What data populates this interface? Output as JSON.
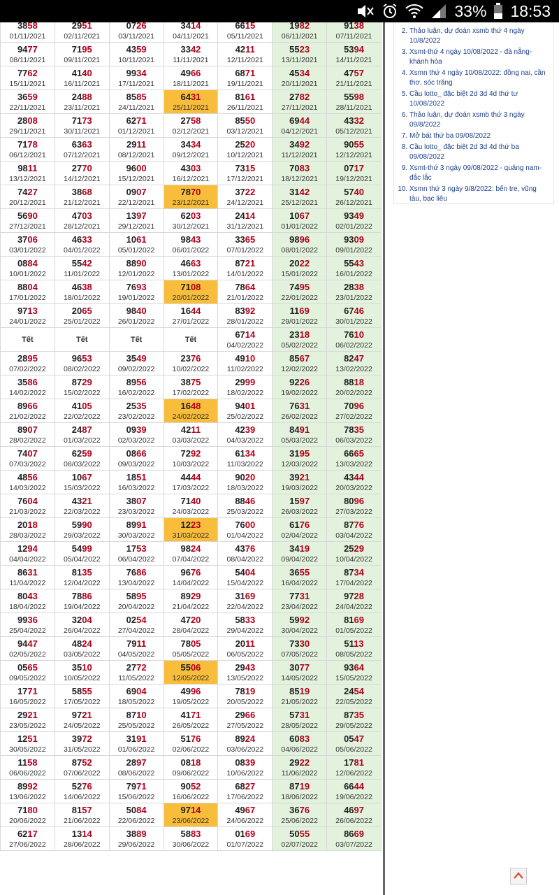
{
  "status": {
    "battery_pct": "33%",
    "time": "18:53"
  },
  "icons": {
    "mute": "mute-icon",
    "alarm": "alarm-icon",
    "wifi": "wifi-icon",
    "signal": "signal-icon",
    "battery": "battery-icon",
    "scroll_top": "chevron-up-icon"
  },
  "colors": {
    "highlight": "#b3001b",
    "weekend": "#e3f2dc",
    "special": "#f8bd3b"
  },
  "sidebar": {
    "start": 2,
    "items": [
      "Thảo luận, dự đoán xsmb thứ 4 ngày 10/8/2022",
      "Xsmt-thứ 4 ngày 10/08/2022 - đà nẵng-khánh hòa",
      "Xsmn thứ 4 ngày 10/08/2022: đồng nai, cần thơ, sóc trăng",
      "Cầu lotto_ đặc biệt 2d 3d 4d thứ tư 10/08/2022",
      "Thảo luận, dự đoán xsmb thứ 3 ngày 09/8/2022",
      "Mở bát thứ ba 09/08/2022",
      "Cầu lotto_ đặc biệt 2d 3d 4d thứ ba 09/08/2022",
      "Xsmt-thứ 3 ngày 09/08/2022 - quảng nam-đắc lắc",
      "Xsmn thứ 3 ngày 9/8/2022: bến tre, vũng tàu, bạc liêu"
    ]
  },
  "results": [
    [
      [
        "03858",
        "01/11/2021"
      ],
      [
        "02951",
        "02/11/2021"
      ],
      [
        "00726",
        "03/11/2021"
      ],
      [
        "03414",
        "04/11/2021"
      ],
      [
        "06615",
        "05/11/2021"
      ],
      [
        "01982",
        "06/11/2021"
      ],
      [
        "09138",
        "07/11/2021"
      ]
    ],
    [
      [
        "09477",
        "08/11/2021"
      ],
      [
        "07195",
        "09/11/2021"
      ],
      [
        "04359",
        "10/11/2021"
      ],
      [
        "03342",
        "11/11/2021"
      ],
      [
        "04211",
        "12/11/2021"
      ],
      [
        "05523",
        "13/11/2021"
      ],
      [
        "05394",
        "14/11/2021"
      ]
    ],
    [
      [
        "07762",
        "15/11/2021"
      ],
      [
        "04140",
        "16/11/2021"
      ],
      [
        "09934",
        "17/11/2021"
      ],
      [
        "04966",
        "18/11/2021"
      ],
      [
        "06871",
        "19/11/2021"
      ],
      [
        "04534",
        "20/11/2021"
      ],
      [
        "04757",
        "21/11/2021"
      ]
    ],
    [
      [
        "03659",
        "22/11/2021"
      ],
      [
        "02488",
        "23/11/2021"
      ],
      [
        "08585",
        "24/11/2021"
      ],
      [
        "06431",
        "25/11/2021",
        "sp"
      ],
      [
        "08161",
        "26/11/2021"
      ],
      [
        "02782",
        "27/11/2021"
      ],
      [
        "05598",
        "28/11/2021"
      ]
    ],
    [
      [
        "02808",
        "29/11/2021"
      ],
      [
        "07173",
        "30/11/2021"
      ],
      [
        "06271",
        "01/12/2021"
      ],
      [
        "02758",
        "02/12/2021"
      ],
      [
        "08550",
        "03/12/2021"
      ],
      [
        "06944",
        "04/12/2021"
      ],
      [
        "04332",
        "05/12/2021"
      ]
    ],
    [
      [
        "07178",
        "06/12/2021"
      ],
      [
        "06363",
        "07/12/2021"
      ],
      [
        "02911",
        "08/12/2021"
      ],
      [
        "03434",
        "09/12/2021"
      ],
      [
        "02520",
        "10/12/2021"
      ],
      [
        "03492",
        "11/12/2021"
      ],
      [
        "09055",
        "12/12/2021"
      ]
    ],
    [
      [
        "09811",
        "13/12/2021"
      ],
      [
        "02770",
        "14/12/2021"
      ],
      [
        "09600",
        "15/12/2021"
      ],
      [
        "04303",
        "16/12/2021"
      ],
      [
        "07315",
        "17/12/2021"
      ],
      [
        "07083",
        "18/12/2021"
      ],
      [
        "00717",
        "19/12/2021"
      ]
    ],
    [
      [
        "07427",
        "20/12/2021"
      ],
      [
        "03868",
        "21/12/2021"
      ],
      [
        "00907",
        "22/12/2021"
      ],
      [
        "07870",
        "23/12/2021",
        "sp"
      ],
      [
        "03722",
        "24/12/2021"
      ],
      [
        "03142",
        "25/12/2021"
      ],
      [
        "05740",
        "26/12/2021"
      ]
    ],
    [
      [
        "05690",
        "27/12/2021"
      ],
      [
        "04703",
        "28/12/2021"
      ],
      [
        "01397",
        "29/12/2021"
      ],
      [
        "06203",
        "30/12/2021"
      ],
      [
        "02414",
        "31/12/2021"
      ],
      [
        "01067",
        "01/01/2022"
      ],
      [
        "09349",
        "02/01/2022"
      ]
    ],
    [
      [
        "03706",
        "03/01/2022"
      ],
      [
        "04633",
        "04/01/2022"
      ],
      [
        "01061",
        "05/01/2022"
      ],
      [
        "09843",
        "06/01/2022"
      ],
      [
        "03365",
        "07/01/2022"
      ],
      [
        "09896",
        "08/01/2022"
      ],
      [
        "09309",
        "09/01/2022"
      ]
    ],
    [
      [
        "00884",
        "10/01/2022"
      ],
      [
        "05542",
        "11/01/2022"
      ],
      [
        "08890",
        "12/01/2022"
      ],
      [
        "04663",
        "13/01/2022"
      ],
      [
        "08721",
        "14/01/2022"
      ],
      [
        "02022",
        "15/01/2022"
      ],
      [
        "05543",
        "16/01/2022"
      ]
    ],
    [
      [
        "08804",
        "17/01/2022"
      ],
      [
        "04638",
        "18/01/2022"
      ],
      [
        "07693",
        "19/01/2022"
      ],
      [
        "07108",
        "20/01/2022",
        "sp"
      ],
      [
        "07864",
        "21/01/2022"
      ],
      [
        "07495",
        "22/01/2022"
      ],
      [
        "02838",
        "23/01/2022"
      ]
    ],
    [
      [
        "09713",
        "24/01/2022"
      ],
      [
        "02065",
        "25/01/2022"
      ],
      [
        "09840",
        "26/01/2022"
      ],
      [
        "01644",
        "27/01/2022"
      ],
      [
        "08392",
        "28/01/2022"
      ],
      [
        "01169",
        "29/01/2022"
      ],
      [
        "06746",
        "30/01/2022"
      ]
    ],
    [
      [
        "Tết",
        ""
      ],
      [
        "Tết",
        ""
      ],
      [
        "Tết",
        ""
      ],
      [
        "Tết",
        ""
      ],
      [
        "06714",
        "04/02/2022"
      ],
      [
        "02318",
        "05/02/2022"
      ],
      [
        "07610",
        "06/02/2022"
      ]
    ],
    [
      [
        "02895",
        "07/02/2022"
      ],
      [
        "09653",
        "08/02/2022"
      ],
      [
        "03549",
        "09/02/2022"
      ],
      [
        "02376",
        "10/02/2022"
      ],
      [
        "04910",
        "11/02/2022"
      ],
      [
        "08567",
        "12/02/2022"
      ],
      [
        "08247",
        "13/02/2022"
      ]
    ],
    [
      [
        "03586",
        "14/02/2022"
      ],
      [
        "08729",
        "15/02/2022"
      ],
      [
        "08956",
        "16/02/2022"
      ],
      [
        "03875",
        "17/02/2022"
      ],
      [
        "02999",
        "18/02/2022"
      ],
      [
        "09226",
        "19/02/2022"
      ],
      [
        "08818",
        "20/02/2022"
      ]
    ],
    [
      [
        "08966",
        "21/02/2022"
      ],
      [
        "04105",
        "22/02/2022"
      ],
      [
        "02535",
        "23/02/2022"
      ],
      [
        "01648",
        "24/02/2022",
        "sp"
      ],
      [
        "09401",
        "25/02/2022"
      ],
      [
        "07631",
        "26/02/2022"
      ],
      [
        "07096",
        "27/02/2022"
      ]
    ],
    [
      [
        "08907",
        "28/02/2022"
      ],
      [
        "02487",
        "01/03/2022"
      ],
      [
        "00939",
        "02/03/2022"
      ],
      [
        "04211",
        "03/03/2022"
      ],
      [
        "04239",
        "04/03/2022"
      ],
      [
        "08491",
        "05/03/2022"
      ],
      [
        "07835",
        "06/03/2022"
      ]
    ],
    [
      [
        "07407",
        "07/03/2022"
      ],
      [
        "06259",
        "08/03/2022"
      ],
      [
        "00866",
        "09/03/2022"
      ],
      [
        "07292",
        "10/03/2022"
      ],
      [
        "06134",
        "11/03/2022"
      ],
      [
        "03195",
        "12/03/2022"
      ],
      [
        "06665",
        "13/03/2022"
      ]
    ],
    [
      [
        "04856",
        "14/03/2022"
      ],
      [
        "01067",
        "15/03/2022"
      ],
      [
        "01851",
        "16/03/2022"
      ],
      [
        "04444",
        "17/03/2022"
      ],
      [
        "09020",
        "18/03/2022"
      ],
      [
        "03921",
        "19/03/2022"
      ],
      [
        "04344",
        "20/03/2022"
      ]
    ],
    [
      [
        "07604",
        "21/03/2022"
      ],
      [
        "04321",
        "22/03/2022"
      ],
      [
        "03807",
        "23/03/2022"
      ],
      [
        "07140",
        "24/03/2022"
      ],
      [
        "08846",
        "25/03/2022"
      ],
      [
        "01597",
        "26/03/2022"
      ],
      [
        "08096",
        "27/03/2022"
      ]
    ],
    [
      [
        "02018",
        "28/03/2022"
      ],
      [
        "05990",
        "29/03/2022"
      ],
      [
        "08991",
        "30/03/2022"
      ],
      [
        "01223",
        "31/03/2022",
        "sp"
      ],
      [
        "07600",
        "01/04/2022"
      ],
      [
        "06176",
        "02/04/2022"
      ],
      [
        "08776",
        "03/04/2022"
      ]
    ],
    [
      [
        "01294",
        "04/04/2022"
      ],
      [
        "05499",
        "05/04/2022"
      ],
      [
        "01753",
        "06/04/2022"
      ],
      [
        "09824",
        "07/04/2022"
      ],
      [
        "04376",
        "08/04/2022"
      ],
      [
        "03419",
        "09/04/2022"
      ],
      [
        "02529",
        "10/04/2022"
      ]
    ],
    [
      [
        "08631",
        "11/04/2022"
      ],
      [
        "08135",
        "12/04/2022"
      ],
      [
        "07686",
        "13/04/2022"
      ],
      [
        "09676",
        "14/04/2022"
      ],
      [
        "05404",
        "15/04/2022"
      ],
      [
        "03655",
        "16/04/2022"
      ],
      [
        "08734",
        "17/04/2022"
      ]
    ],
    [
      [
        "08043",
        "18/04/2022"
      ],
      [
        "07886",
        "19/04/2022"
      ],
      [
        "05895",
        "20/04/2022"
      ],
      [
        "08929",
        "21/04/2022"
      ],
      [
        "03169",
        "22/04/2022"
      ],
      [
        "07731",
        "23/04/2022"
      ],
      [
        "09728",
        "24/04/2022"
      ]
    ],
    [
      [
        "09936",
        "25/04/2022"
      ],
      [
        "03204",
        "26/04/2022"
      ],
      [
        "00254",
        "27/04/2022"
      ],
      [
        "04720",
        "28/04/2022"
      ],
      [
        "05833",
        "29/04/2022"
      ],
      [
        "05992",
        "30/04/2022"
      ],
      [
        "08169",
        "01/05/2022"
      ]
    ],
    [
      [
        "09447",
        "02/05/2022"
      ],
      [
        "04824",
        "03/05/2022"
      ],
      [
        "07911",
        "04/05/2022"
      ],
      [
        "07805",
        "05/05/2022"
      ],
      [
        "02011",
        "06/05/2022"
      ],
      [
        "07330",
        "07/05/2022"
      ],
      [
        "05113",
        "08/05/2022"
      ]
    ],
    [
      [
        "00565",
        "09/05/2022"
      ],
      [
        "03510",
        "10/05/2022"
      ],
      [
        "02772",
        "11/05/2022"
      ],
      [
        "05506",
        "12/05/2022",
        "sp"
      ],
      [
        "02943",
        "13/05/2022"
      ],
      [
        "03077",
        "14/05/2022"
      ],
      [
        "09364",
        "15/05/2022"
      ]
    ],
    [
      [
        "01771",
        "16/05/2022"
      ],
      [
        "05855",
        "17/05/2022"
      ],
      [
        "06904",
        "18/05/2022"
      ],
      [
        "04996",
        "19/05/2022"
      ],
      [
        "07819",
        "20/05/2022"
      ],
      [
        "08519",
        "21/05/2022"
      ],
      [
        "02454",
        "22/05/2022"
      ]
    ],
    [
      [
        "02921",
        "23/05/2022"
      ],
      [
        "09721",
        "24/05/2022"
      ],
      [
        "08710",
        "25/05/2022"
      ],
      [
        "04171",
        "26/05/2022"
      ],
      [
        "02966",
        "27/05/2022"
      ],
      [
        "05731",
        "28/05/2022"
      ],
      [
        "08735",
        "29/05/2022"
      ]
    ],
    [
      [
        "01251",
        "30/05/2022"
      ],
      [
        "03972",
        "31/05/2022"
      ],
      [
        "03191",
        "01/06/2022"
      ],
      [
        "05176",
        "02/06/2022"
      ],
      [
        "08924",
        "03/06/2022"
      ],
      [
        "06083",
        "04/06/2022"
      ],
      [
        "00547",
        "05/06/2022"
      ]
    ],
    [
      [
        "01158",
        "06/06/2022"
      ],
      [
        "08752",
        "07/06/2022"
      ],
      [
        "02897",
        "08/06/2022"
      ],
      [
        "00818",
        "09/06/2022"
      ],
      [
        "00839",
        "10/06/2022"
      ],
      [
        "02922",
        "11/06/2022"
      ],
      [
        "01781",
        "12/06/2022"
      ]
    ],
    [
      [
        "08992",
        "13/06/2022"
      ],
      [
        "05276",
        "14/06/2022"
      ],
      [
        "07971",
        "15/06/2022"
      ],
      [
        "09052",
        "16/06/2022"
      ],
      [
        "06827",
        "17/06/2022"
      ],
      [
        "08719",
        "18/06/2022"
      ],
      [
        "06644",
        "19/06/2022"
      ]
    ],
    [
      [
        "07180",
        "20/06/2022"
      ],
      [
        "08157",
        "21/06/2022"
      ],
      [
        "05084",
        "22/06/2022"
      ],
      [
        "09714",
        "23/06/2022",
        "sp"
      ],
      [
        "04967",
        "24/06/2022"
      ],
      [
        "03676",
        "25/06/2022"
      ],
      [
        "04697",
        "26/06/2022"
      ]
    ],
    [
      [
        "06217",
        "27/06/2022"
      ],
      [
        "01314",
        "28/06/2022"
      ],
      [
        "03889",
        "29/06/2022"
      ],
      [
        "05883",
        "30/06/2022"
      ],
      [
        "00169",
        "01/07/2022"
      ],
      [
        "05055",
        "02/07/2022"
      ],
      [
        "08669",
        "03/07/2022"
      ]
    ]
  ]
}
